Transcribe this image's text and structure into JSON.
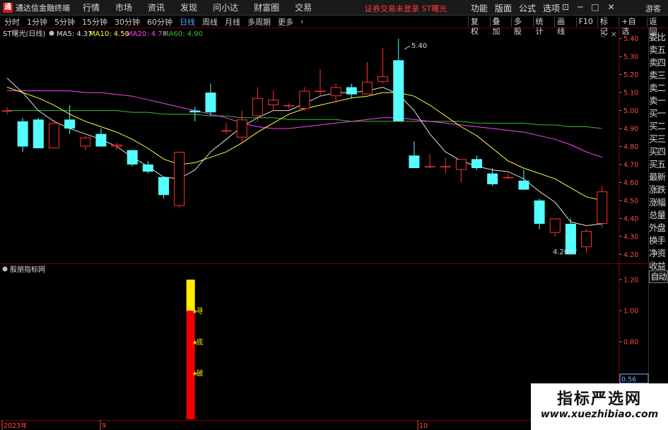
{
  "app": {
    "title": "通达信金融终端",
    "logo": "通"
  },
  "menu": [
    "行情",
    "市场",
    "资讯",
    "发现",
    "问小达",
    "财富圈",
    "交易"
  ],
  "status_text": "证券交易未登录  ST曙光",
  "top_right": [
    "功能",
    "版面",
    "公式",
    "选项"
  ],
  "window_controls": [
    "⊡",
    "─",
    "□",
    "✕"
  ],
  "guest": "游客",
  "periods": [
    "分时",
    "1分钟",
    "5分钟",
    "15分钟",
    "30分钟",
    "60分钟",
    "日线",
    "周线",
    "月线",
    "多周期",
    "更多"
  ],
  "active_period": "日线",
  "tools": [
    "复权",
    "叠加",
    "多股",
    "统计",
    "画线",
    "F10",
    "标记",
    "+自选",
    "返回"
  ],
  "main_legend": {
    "title": "ST曙光(日线)",
    "ma5": "MA5: 4.37",
    "ma10": "MA10: 4.50",
    "ma20": "MA20: 4.74",
    "ma60": "MA60: 4.90"
  },
  "indicator_title": "股朋指标网",
  "colors": {
    "up": "#ff3232",
    "down": "#54ffff",
    "ma5": "#e0e0e0",
    "ma10": "#ffff40",
    "ma20": "#ff40ff",
    "ma60": "#30c030",
    "axis": "#ff4a4a",
    "frame": "#8a0000"
  },
  "price_axis": [
    "5.40",
    "5.30",
    "5.20",
    "5.10",
    "5.00",
    "4.90",
    "4.80",
    "4.70",
    "4.60",
    "4.50",
    "4.40",
    "4.30",
    "4.20"
  ],
  "sub_axis": [
    "1.20",
    "1.00",
    "0.80",
    "0.56",
    "0.40"
  ],
  "sub_axis_highlight": "0.56",
  "date_labels": [
    "2023年",
    "9",
    "10"
  ],
  "high_label": "5.40",
  "low_label": "4.20",
  "signals": [
    "寻",
    "底",
    "破"
  ],
  "quote_labels": [
    "委比",
    "卖五",
    "卖四",
    "卖三",
    "卖二",
    "卖一",
    "买一",
    "买二",
    "买三",
    "买四",
    "买五",
    "最新",
    "涨跌",
    "涨幅",
    "总量",
    "外盘",
    "换手",
    "净资",
    "收益"
  ],
  "autoscale_label": "自动",
  "watermark": {
    "title": "指标严选网",
    "url": "www.xuezhibiao.com"
  },
  "chart_data": {
    "type": "candlestick",
    "y_range": [
      4.15,
      5.45
    ],
    "candles": [
      {
        "o": 5.0,
        "h": 5.02,
        "l": 4.98,
        "c": 5.0
      },
      {
        "o": 4.94,
        "h": 4.96,
        "l": 4.77,
        "c": 4.8
      },
      {
        "o": 4.95,
        "h": 4.96,
        "l": 4.79,
        "c": 4.79
      },
      {
        "o": 4.79,
        "h": 4.95,
        "l": 4.79,
        "c": 4.93
      },
      {
        "o": 4.95,
        "h": 5.03,
        "l": 4.87,
        "c": 4.9
      },
      {
        "o": 4.8,
        "h": 4.86,
        "l": 4.78,
        "c": 4.85
      },
      {
        "o": 4.87,
        "h": 4.9,
        "l": 4.8,
        "c": 4.8
      },
      {
        "o": 4.8,
        "h": 4.82,
        "l": 4.78,
        "c": 4.81
      },
      {
        "o": 4.78,
        "h": 4.78,
        "l": 4.69,
        "c": 4.7
      },
      {
        "o": 4.7,
        "h": 4.72,
        "l": 4.65,
        "c": 4.66
      },
      {
        "o": 4.63,
        "h": 4.63,
        "l": 4.51,
        "c": 4.53
      },
      {
        "o": 4.47,
        "h": 4.77,
        "l": 4.46,
        "c": 4.77
      },
      {
        "o": 5.0,
        "h": 5.02,
        "l": 4.94,
        "c": 4.99
      },
      {
        "o": 5.1,
        "h": 5.15,
        "l": 4.97,
        "c": 4.99
      },
      {
        "o": 4.89,
        "h": 4.93,
        "l": 4.87,
        "c": 4.89
      },
      {
        "o": 4.85,
        "h": 5.0,
        "l": 4.82,
        "c": 4.95
      },
      {
        "o": 4.97,
        "h": 5.13,
        "l": 4.94,
        "c": 5.07
      },
      {
        "o": 5.03,
        "h": 5.11,
        "l": 5.0,
        "c": 5.06
      },
      {
        "o": 5.03,
        "h": 5.04,
        "l": 5.01,
        "c": 5.03
      },
      {
        "o": 5.01,
        "h": 5.13,
        "l": 5.0,
        "c": 5.11
      },
      {
        "o": 5.11,
        "h": 5.23,
        "l": 5.08,
        "c": 5.11
      },
      {
        "o": 5.08,
        "h": 5.15,
        "l": 5.04,
        "c": 5.13
      },
      {
        "o": 5.13,
        "h": 5.15,
        "l": 5.07,
        "c": 5.09
      },
      {
        "o": 5.09,
        "h": 5.27,
        "l": 5.09,
        "c": 5.16
      },
      {
        "o": 5.16,
        "h": 5.35,
        "l": 5.15,
        "c": 5.19
      },
      {
        "o": 5.28,
        "h": 5.4,
        "l": 4.94,
        "c": 4.94
      },
      {
        "o": 4.75,
        "h": 4.83,
        "l": 4.68,
        "c": 4.68
      },
      {
        "o": 4.69,
        "h": 4.76,
        "l": 4.68,
        "c": 4.69
      },
      {
        "o": 4.69,
        "h": 4.74,
        "l": 4.65,
        "c": 4.69
      },
      {
        "o": 4.67,
        "h": 4.72,
        "l": 4.6,
        "c": 4.73
      },
      {
        "o": 4.73,
        "h": 4.75,
        "l": 4.67,
        "c": 4.68
      },
      {
        "o": 4.65,
        "h": 4.68,
        "l": 4.58,
        "c": 4.59
      },
      {
        "o": 4.63,
        "h": 4.65,
        "l": 4.62,
        "c": 4.63
      },
      {
        "o": 4.61,
        "h": 4.67,
        "l": 4.56,
        "c": 4.56
      },
      {
        "o": 4.5,
        "h": 4.51,
        "l": 4.34,
        "c": 4.37
      },
      {
        "o": 4.32,
        "h": 4.37,
        "l": 4.3,
        "c": 4.4
      },
      {
        "o": 4.37,
        "h": 4.4,
        "l": 4.2,
        "c": 4.2
      },
      {
        "o": 4.24,
        "h": 4.34,
        "l": 4.21,
        "c": 4.33
      },
      {
        "o": 4.37,
        "h": 4.58,
        "l": 4.35,
        "c": 4.55
      }
    ],
    "ma60": [
      5.0,
      5.0,
      5.0,
      5.0,
      5.0,
      5.0,
      5.0,
      5.0,
      4.99,
      4.99,
      4.98,
      4.98,
      4.98,
      4.97,
      4.97,
      4.96,
      4.96,
      4.96,
      4.95,
      4.95,
      4.95,
      4.95,
      4.94,
      4.94,
      4.94,
      4.94,
      4.94,
      4.94,
      4.94,
      4.94,
      4.93,
      4.93,
      4.93,
      4.93,
      4.92,
      4.92,
      4.91,
      4.91,
      4.9
    ],
    "ma20": [
      5.11,
      5.11,
      5.11,
      5.11,
      5.11,
      5.1,
      5.1,
      5.09,
      5.08,
      5.06,
      5.04,
      5.02,
      5.0,
      4.98,
      4.96,
      4.93,
      4.91,
      4.9,
      4.9,
      4.91,
      4.92,
      4.93,
      4.94,
      4.95,
      4.96,
      4.96,
      4.95,
      4.94,
      4.93,
      4.92,
      4.91,
      4.9,
      4.89,
      4.88,
      4.86,
      4.84,
      4.81,
      4.77,
      4.74
    ],
    "ma10": [
      5.13,
      5.1,
      5.07,
      5.03,
      4.98,
      4.94,
      4.91,
      4.88,
      4.84,
      4.79,
      4.73,
      4.7,
      4.71,
      4.74,
      4.77,
      4.82,
      4.88,
      4.93,
      4.98,
      5.01,
      5.03,
      5.05,
      5.07,
      5.08,
      5.1,
      5.1,
      5.08,
      5.03,
      4.97,
      4.91,
      4.86,
      4.79,
      4.72,
      4.68,
      4.65,
      4.62,
      4.57,
      4.52,
      4.5
    ],
    "ma5": [
      5.18,
      5.1,
      5.0,
      4.94,
      4.9,
      4.87,
      4.84,
      4.8,
      4.74,
      4.69,
      4.63,
      4.62,
      4.67,
      4.77,
      4.84,
      4.91,
      4.96,
      5.0,
      5.0,
      5.04,
      5.08,
      5.1,
      5.1,
      5.11,
      5.13,
      5.09,
      5.0,
      4.87,
      4.77,
      4.72,
      4.69,
      4.67,
      4.66,
      4.62,
      4.55,
      4.49,
      4.38,
      4.36,
      4.37
    ],
    "indicator": {
      "y_range": [
        0.3,
        1.3
      ],
      "bar_index": 11,
      "red_from": 0.0,
      "red_to": 1.0,
      "yellow_from": 1.0,
      "yellow_to": 1.2,
      "signal_levels": [
        1.0,
        0.8,
        0.6
      ]
    }
  }
}
